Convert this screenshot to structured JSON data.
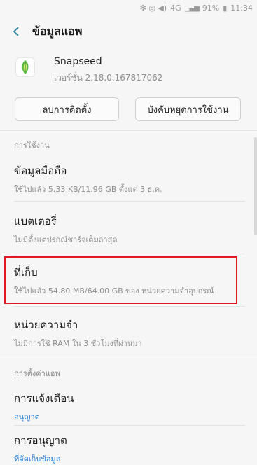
{
  "status_bar": {
    "network": "4G",
    "battery": "91%",
    "time": "11:34"
  },
  "app_bar": {
    "back_icon": "chevron-left-icon",
    "title": "ข้อมูลแอพ"
  },
  "app": {
    "icon": "snapseed-leaf-icon",
    "name": "Snapseed",
    "version": "เวอร์ชั่น 2.18.0.167817062"
  },
  "buttons": {
    "uninstall": "ลบการติดตั้ง",
    "force_stop": "บังคับหยุดการใช้งาน"
  },
  "sections": {
    "usage": "การใช้งาน",
    "app_settings": "การตั้งค่าแอพ"
  },
  "items": {
    "mobile_data": {
      "title": "ข้อมูลมือถือ",
      "sub": "ใช้ไปแล้ว 5.33 KB/11.96 GB ตั้งแต่ 3 ธ.ค."
    },
    "battery": {
      "title": "แบตเตอรี่",
      "sub": "ไม่มีตั้งแต่ปรกณ์ชาร์จเต็มล่าสุด"
    },
    "storage": {
      "title": "ที่เก็บ",
      "sub": "ใช้ไปแล้ว 54.80 MB/64.00 GB ของ หน่วยความจำอุปกรณ์"
    },
    "memory": {
      "title": "หน่วยความจำ",
      "sub": "ไม่มีการใช้ RAM ใน 3 ชั่วโมงที่ผ่านมา"
    },
    "notifications": {
      "title": "การแจ้งเตือน",
      "sub": "อนุญาต"
    },
    "permissions": {
      "title": "การอนุญาต",
      "sub": "ที่จัดเก็บข้อมูล"
    }
  },
  "colors": {
    "highlight": "#e11b22",
    "link": "#2a7fd3",
    "back_arrow": "#3d8ea8"
  }
}
